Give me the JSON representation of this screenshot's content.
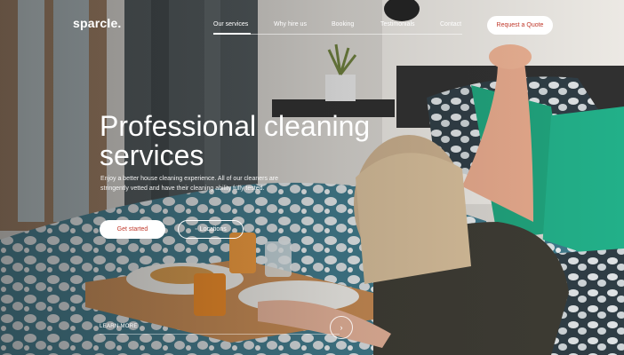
{
  "header": {
    "logo": "sparcle.",
    "nav": [
      {
        "label": "Our services"
      },
      {
        "label": "Why hire us"
      },
      {
        "label": "Booking"
      },
      {
        "label": "Testimonials"
      },
      {
        "label": "Contact"
      }
    ],
    "quote_button": "Request a Quote"
  },
  "hero": {
    "title_line1": "Professional cleaning",
    "title_line2": "services",
    "subtitle": "Enjoy a better house cleaning experience. All of our cleaners are stringently vetted and have their cleaning ability fully tested.",
    "primary_button": "Get started",
    "secondary_button": "Locations",
    "learn_more": "LEARN MORE"
  },
  "icons": {
    "location": "map-pin-icon",
    "scroll": "chevron-right-icon"
  },
  "colors": {
    "accent": "#c0392b",
    "text_light": "#ffffff"
  }
}
